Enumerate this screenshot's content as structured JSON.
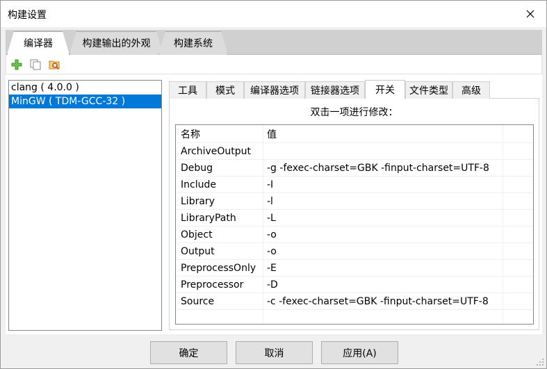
{
  "window": {
    "title": "构建设置",
    "close_icon": "close-icon"
  },
  "main_tabs": [
    {
      "label": "编译器",
      "active": true
    },
    {
      "label": "构建输出的外观",
      "active": false
    },
    {
      "label": "构建系统",
      "active": false
    }
  ],
  "toolbar": {
    "icons": [
      "add-icon",
      "copy-icon",
      "find-folder-icon"
    ],
    "colors": {
      "add": "#3a9a2a",
      "find": "#c04020"
    }
  },
  "compilers": [
    {
      "label": "clang ( 4.0.0 )",
      "selected": false
    },
    {
      "label": "MinGW ( TDM-GCC-32 )",
      "selected": true
    }
  ],
  "sub_tabs": [
    {
      "label": "工具",
      "active": false
    },
    {
      "label": "模式",
      "active": false
    },
    {
      "label": "编译器选项",
      "active": false
    },
    {
      "label": "链接器选项",
      "active": false
    },
    {
      "label": "开关",
      "active": true
    },
    {
      "label": "文件类型",
      "active": false
    },
    {
      "label": "高级",
      "active": false
    }
  ],
  "switches": {
    "hint": "双击一项进行修改：",
    "columns": {
      "name": "名称",
      "value": "值"
    },
    "rows": [
      {
        "name": "ArchiveOutput",
        "value": ""
      },
      {
        "name": "Debug",
        "value": "-g -fexec-charset=GBK -finput-charset=UTF-8"
      },
      {
        "name": "Include",
        "value": "-I"
      },
      {
        "name": "Library",
        "value": "-l"
      },
      {
        "name": "LibraryPath",
        "value": "-L"
      },
      {
        "name": "Object",
        "value": "-o"
      },
      {
        "name": "Output",
        "value": "-o"
      },
      {
        "name": "PreprocessOnly",
        "value": "-E"
      },
      {
        "name": "Preprocessor",
        "value": "-D"
      },
      {
        "name": "Source",
        "value": "-c -fexec-charset=GBK -finput-charset=UTF-8"
      },
      {
        "name": "",
        "value": ""
      }
    ]
  },
  "buttons": {
    "ok": "确定",
    "cancel": "取消",
    "apply": "应用(A)"
  },
  "accent": "#0078d7"
}
